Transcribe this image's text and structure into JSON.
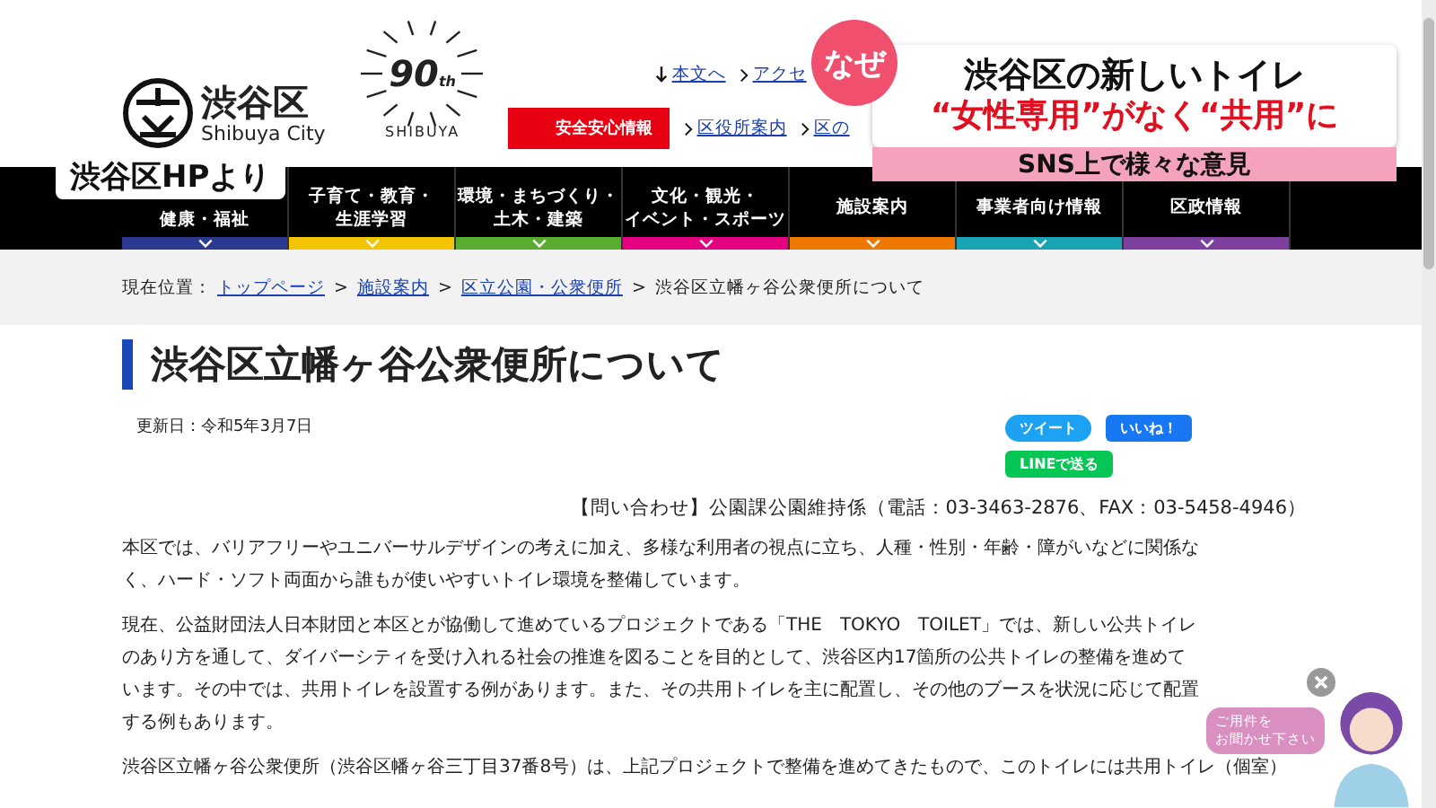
{
  "header": {
    "logo_name": "渋谷区",
    "logo_subtitle": "Shibuya City",
    "anniversary_number": "90",
    "anniversary_suffix": "th",
    "anniversary_city": "SHIBUYA",
    "top_links": [
      {
        "label": "本文へ",
        "kind": "down"
      },
      {
        "label": "アクセ",
        "kind": "next"
      }
    ],
    "safety_button": "安全安心情報",
    "sub_links": [
      "区役所案内",
      "区の"
    ]
  },
  "nav": [
    {
      "lines": [
        "健康・福祉"
      ],
      "color": "#2b3990"
    },
    {
      "lines": [
        "子育て・教育・",
        "生涯学習"
      ],
      "color": "#f2c500"
    },
    {
      "lines": [
        "環境・まちづくり・",
        "土木・建築"
      ],
      "color": "#5aac2e"
    },
    {
      "lines": [
        "文化・観光・",
        "イベント・スポーツ"
      ],
      "color": "#e4007f"
    },
    {
      "lines": [
        "施設案内"
      ],
      "color": "#ee7800"
    },
    {
      "lines": [
        "事業者向け情報"
      ],
      "color": "#1aa3b5"
    },
    {
      "lines": [
        "区政情報"
      ],
      "color": "#7d3fa0"
    }
  ],
  "breadcrumb": {
    "prefix": "現在位置：",
    "links": [
      "トップページ",
      "施設案内",
      "区立公園・公衆便所"
    ],
    "separator": ">",
    "current": "渋谷区立幡ヶ谷公衆便所について"
  },
  "page": {
    "title": "渋谷区立幡ヶ谷公衆便所について",
    "updated": "更新日：令和5年3月7日",
    "share": [
      {
        "label": "ツイート",
        "kind": "twitter"
      },
      {
        "label": "いいね！",
        "kind": "facebook"
      },
      {
        "label": "LINEで送る",
        "kind": "line"
      }
    ],
    "inquiry": "【問い合わせ】公園課公園維持係（電話：03-3463-2876、FAX：03-5458-4946）",
    "paragraphs": [
      "本区では、バリアフリーやユニバーサルデザインの考えに加え、多様な利用者の視点に立ち、人種・性別・年齢・障がいなどに関係なく、ハード・ソフト両面から誰もが使いやすいトイレ環境を整備しています。",
      "現在、公益財団法人日本財団と本区とが協働して進めているプロジェクトである「THE　TOKYO　TOILET」では、新しい公共トイレのあり方を通して、ダイバーシティを受け入れる社会の推進を図ることを目的として、渋谷区内17箇所の公共トイレの整備を進めています。その中では、共用トイレを設置する例があります。また、その共用トイレを主に配置し、その他のブースを状況に応じて配置する例もあります。",
      "渋谷区立幡ヶ谷公衆便所（渋谷区幡ヶ谷三丁目37番8号）は、上記プロジェクトで整備を進めてきたもので、このトイレには共用トイレ（個室）"
    ]
  },
  "chat_widget": {
    "message": [
      "ご用件を",
      "お聞かせ下さい"
    ]
  },
  "news_caption": {
    "source": "渋谷区HPより",
    "badge": "なぜ",
    "headline": "渋谷区の新しいトイレ",
    "subheadline": "“女性専用”がなく“共用”に",
    "band": "SNS上で様々な意見"
  }
}
